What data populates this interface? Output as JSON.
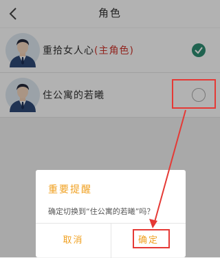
{
  "header": {
    "title": "角色",
    "back_icon": "chevron-left-icon"
  },
  "roles": [
    {
      "name": "重拾女人心",
      "tag": "(主角色)",
      "selected": true
    },
    {
      "name": "住公寓的若曦",
      "tag": "",
      "selected": false
    }
  ],
  "dialog": {
    "title": "重要提醒",
    "message": "确定切换到“住公寓的若曦”吗？",
    "cancel_label": "取消",
    "confirm_label": "确定"
  },
  "colors": {
    "accent": "#f0a020",
    "check": "#2f8f73",
    "annotation": "#e53935",
    "role_tag": "#d0342c"
  }
}
